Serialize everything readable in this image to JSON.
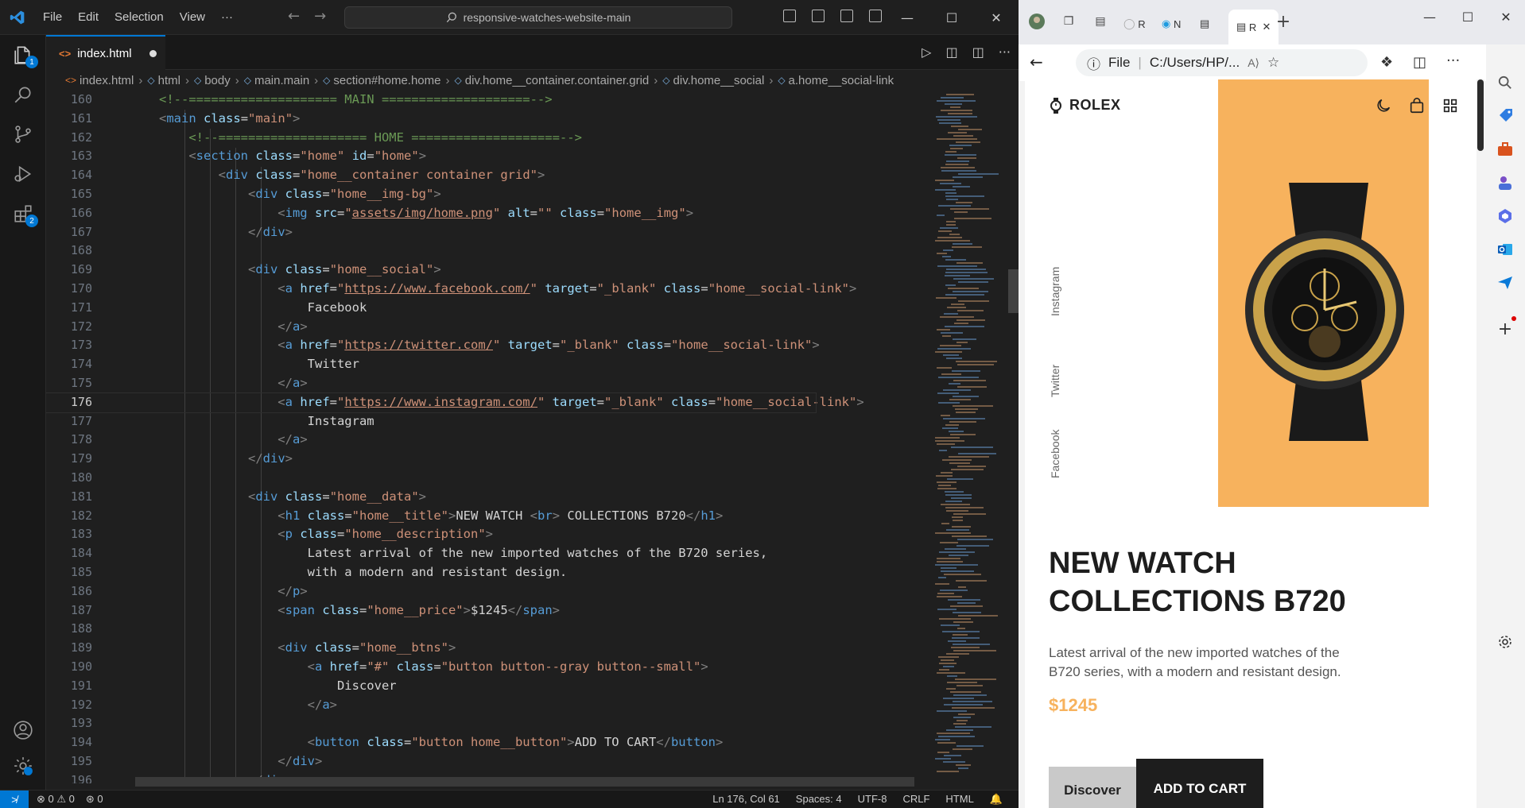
{
  "vscode": {
    "menu": [
      "File",
      "Edit",
      "Selection",
      "View",
      "···"
    ],
    "command_center": "responsive-watches-website-main",
    "tab": {
      "icon": "<>",
      "label": "index.html"
    },
    "activity_badges": {
      "explorer": "1",
      "extensions": "2"
    },
    "breadcrumb": [
      "index.html",
      "html",
      "body",
      "main.main",
      "section#home.home",
      "div.home__container.container.grid",
      "div.home__social",
      "a.home__social-link"
    ],
    "line_numbers": [
      "160",
      "161",
      "162",
      "163",
      "164",
      "165",
      "166",
      "167",
      "168",
      "169",
      "170",
      "171",
      "172",
      "173",
      "174",
      "175",
      "176",
      "177",
      "178",
      "179",
      "180",
      "181",
      "182",
      "183",
      "184",
      "185",
      "186",
      "187",
      "188",
      "189",
      "190",
      "191",
      "192",
      "193",
      "194",
      "195",
      "196"
    ],
    "active_line": "176",
    "status": {
      "errors": "0",
      "warnings": "0",
      "ports": "0",
      "position": "Ln 176, Col 61",
      "spaces": "Spaces: 4",
      "encoding": "UTF-8",
      "eol": "CRLF",
      "language": "HTML"
    }
  },
  "browser": {
    "address": {
      "scheme": "File",
      "path": "C:/Users/HP/..."
    },
    "tabs": [
      "R",
      "N",
      "R"
    ],
    "site": {
      "logo": "ROLEX",
      "social": [
        "Instagram",
        "Twitter",
        "Facebook"
      ],
      "title": "NEW WATCH\nCOLLECTIONS B720",
      "description": "Latest arrival of the new imported watches of the B720 series, with a modern and resistant design.",
      "price": "$1245",
      "discover": "Discover",
      "add_to_cart": "ADD TO CART",
      "accent_color": "#f7b25d"
    }
  },
  "code_lines": [
    [
      [
        "t-cmt",
        "    <!--==================== MAIN ====================-->"
      ]
    ],
    [
      [
        "t-br",
        "    <"
      ],
      [
        "t-tag",
        "main"
      ],
      [
        "t-txt",
        " "
      ],
      [
        "t-attr",
        "class"
      ],
      [
        "t-txt",
        "="
      ],
      [
        "t-str",
        "\"main\""
      ],
      [
        "t-br",
        ">"
      ]
    ],
    [
      [
        "t-cmt",
        "        <!--==================== HOME ====================-->"
      ]
    ],
    [
      [
        "t-br",
        "        <"
      ],
      [
        "t-tag",
        "section"
      ],
      [
        "t-txt",
        " "
      ],
      [
        "t-attr",
        "class"
      ],
      [
        "t-txt",
        "="
      ],
      [
        "t-str",
        "\"home\""
      ],
      [
        "t-txt",
        " "
      ],
      [
        "t-attr",
        "id"
      ],
      [
        "t-txt",
        "="
      ],
      [
        "t-str",
        "\"home\""
      ],
      [
        "t-br",
        ">"
      ]
    ],
    [
      [
        "t-br",
        "            <"
      ],
      [
        "t-tag",
        "div"
      ],
      [
        "t-txt",
        " "
      ],
      [
        "t-attr",
        "class"
      ],
      [
        "t-txt",
        "="
      ],
      [
        "t-str",
        "\"home__container container grid\""
      ],
      [
        "t-br",
        ">"
      ]
    ],
    [
      [
        "t-br",
        "                <"
      ],
      [
        "t-tag",
        "div"
      ],
      [
        "t-txt",
        " "
      ],
      [
        "t-attr",
        "class"
      ],
      [
        "t-txt",
        "="
      ],
      [
        "t-str",
        "\"home__img-bg\""
      ],
      [
        "t-br",
        ">"
      ]
    ],
    [
      [
        "t-br",
        "                    <"
      ],
      [
        "t-tag",
        "img"
      ],
      [
        "t-txt",
        " "
      ],
      [
        "t-attr",
        "src"
      ],
      [
        "t-txt",
        "="
      ],
      [
        "t-str",
        "\""
      ],
      [
        "t-link",
        "assets/img/home.png"
      ],
      [
        "t-str",
        "\""
      ],
      [
        "t-txt",
        " "
      ],
      [
        "t-attr",
        "alt"
      ],
      [
        "t-txt",
        "="
      ],
      [
        "t-str",
        "\"\""
      ],
      [
        "t-txt",
        " "
      ],
      [
        "t-attr",
        "class"
      ],
      [
        "t-txt",
        "="
      ],
      [
        "t-str",
        "\"home__img\""
      ],
      [
        "t-br",
        ">"
      ]
    ],
    [
      [
        "t-br",
        "                </"
      ],
      [
        "t-tag",
        "div"
      ],
      [
        "t-br",
        ">"
      ]
    ],
    [
      [
        "t-txt",
        ""
      ]
    ],
    [
      [
        "t-br",
        "                <"
      ],
      [
        "t-tag",
        "div"
      ],
      [
        "t-txt",
        " "
      ],
      [
        "t-attr",
        "class"
      ],
      [
        "t-txt",
        "="
      ],
      [
        "t-str",
        "\"home__social\""
      ],
      [
        "t-br",
        ">"
      ]
    ],
    [
      [
        "t-br",
        "                    <"
      ],
      [
        "t-tag",
        "a"
      ],
      [
        "t-txt",
        " "
      ],
      [
        "t-attr",
        "href"
      ],
      [
        "t-txt",
        "="
      ],
      [
        "t-str",
        "\""
      ],
      [
        "t-link",
        "https://www.facebook.com/"
      ],
      [
        "t-str",
        "\""
      ],
      [
        "t-txt",
        " "
      ],
      [
        "t-attr",
        "target"
      ],
      [
        "t-txt",
        "="
      ],
      [
        "t-str",
        "\"_blank\""
      ],
      [
        "t-txt",
        " "
      ],
      [
        "t-attr",
        "class"
      ],
      [
        "t-txt",
        "="
      ],
      [
        "t-str",
        "\"home__social-link\""
      ],
      [
        "t-br",
        ">"
      ]
    ],
    [
      [
        "t-txt",
        "                        Facebook"
      ]
    ],
    [
      [
        "t-br",
        "                    </"
      ],
      [
        "t-tag",
        "a"
      ],
      [
        "t-br",
        ">"
      ]
    ],
    [
      [
        "t-br",
        "                    <"
      ],
      [
        "t-tag",
        "a"
      ],
      [
        "t-txt",
        " "
      ],
      [
        "t-attr",
        "href"
      ],
      [
        "t-txt",
        "="
      ],
      [
        "t-str",
        "\""
      ],
      [
        "t-link",
        "https://twitter.com/"
      ],
      [
        "t-str",
        "\""
      ],
      [
        "t-txt",
        " "
      ],
      [
        "t-attr",
        "target"
      ],
      [
        "t-txt",
        "="
      ],
      [
        "t-str",
        "\"_blank\""
      ],
      [
        "t-txt",
        " "
      ],
      [
        "t-attr",
        "class"
      ],
      [
        "t-txt",
        "="
      ],
      [
        "t-str",
        "\"home__social-link\""
      ],
      [
        "t-br",
        ">"
      ]
    ],
    [
      [
        "t-txt",
        "                        Twitter"
      ]
    ],
    [
      [
        "t-br",
        "                    </"
      ],
      [
        "t-tag",
        "a"
      ],
      [
        "t-br",
        ">"
      ]
    ],
    [
      [
        "t-br",
        "                    <"
      ],
      [
        "t-tag",
        "a"
      ],
      [
        "t-txt",
        " "
      ],
      [
        "t-attr",
        "href"
      ],
      [
        "t-txt",
        "="
      ],
      [
        "t-str",
        "\""
      ],
      [
        "t-link",
        "https://www.instagram.com/"
      ],
      [
        "t-str",
        "\""
      ],
      [
        "t-txt",
        " "
      ],
      [
        "t-attr",
        "target"
      ],
      [
        "t-txt",
        "="
      ],
      [
        "t-str",
        "\"_blank\""
      ],
      [
        "t-txt",
        " "
      ],
      [
        "t-attr",
        "class"
      ],
      [
        "t-txt",
        "="
      ],
      [
        "t-str",
        "\"home__social-link\""
      ],
      [
        "t-br",
        ">"
      ]
    ],
    [
      [
        "t-txt",
        "                        Instagram"
      ]
    ],
    [
      [
        "t-br",
        "                    </"
      ],
      [
        "t-tag",
        "a"
      ],
      [
        "t-br",
        ">"
      ]
    ],
    [
      [
        "t-br",
        "                </"
      ],
      [
        "t-tag",
        "div"
      ],
      [
        "t-br",
        ">"
      ]
    ],
    [
      [
        "t-txt",
        ""
      ]
    ],
    [
      [
        "t-br",
        "                <"
      ],
      [
        "t-tag",
        "div"
      ],
      [
        "t-txt",
        " "
      ],
      [
        "t-attr",
        "class"
      ],
      [
        "t-txt",
        "="
      ],
      [
        "t-str",
        "\"home__data\""
      ],
      [
        "t-br",
        ">"
      ]
    ],
    [
      [
        "t-br",
        "                    <"
      ],
      [
        "t-tag",
        "h1"
      ],
      [
        "t-txt",
        " "
      ],
      [
        "t-attr",
        "class"
      ],
      [
        "t-txt",
        "="
      ],
      [
        "t-str",
        "\"home__title\""
      ],
      [
        "t-br",
        ">"
      ],
      [
        "t-txt",
        "NEW WATCH "
      ],
      [
        "t-br",
        "<"
      ],
      [
        "t-tag",
        "br"
      ],
      [
        "t-br",
        ">"
      ],
      [
        "t-txt",
        " COLLECTIONS B720"
      ],
      [
        "t-br",
        "</"
      ],
      [
        "t-tag",
        "h1"
      ],
      [
        "t-br",
        ">"
      ]
    ],
    [
      [
        "t-br",
        "                    <"
      ],
      [
        "t-tag",
        "p"
      ],
      [
        "t-txt",
        " "
      ],
      [
        "t-attr",
        "class"
      ],
      [
        "t-txt",
        "="
      ],
      [
        "t-str",
        "\"home__description\""
      ],
      [
        "t-br",
        ">"
      ]
    ],
    [
      [
        "t-txt",
        "                        Latest arrival of the new imported watches of the B720 series,"
      ]
    ],
    [
      [
        "t-txt",
        "                        with a modern and resistant design."
      ]
    ],
    [
      [
        "t-br",
        "                    </"
      ],
      [
        "t-tag",
        "p"
      ],
      [
        "t-br",
        ">"
      ]
    ],
    [
      [
        "t-br",
        "                    <"
      ],
      [
        "t-tag",
        "span"
      ],
      [
        "t-txt",
        " "
      ],
      [
        "t-attr",
        "class"
      ],
      [
        "t-txt",
        "="
      ],
      [
        "t-str",
        "\"home__price\""
      ],
      [
        "t-br",
        ">"
      ],
      [
        "t-txt",
        "$1245"
      ],
      [
        "t-br",
        "</"
      ],
      [
        "t-tag",
        "span"
      ],
      [
        "t-br",
        ">"
      ]
    ],
    [
      [
        "t-txt",
        ""
      ]
    ],
    [
      [
        "t-br",
        "                    <"
      ],
      [
        "t-tag",
        "div"
      ],
      [
        "t-txt",
        " "
      ],
      [
        "t-attr",
        "class"
      ],
      [
        "t-txt",
        "="
      ],
      [
        "t-str",
        "\"home__btns\""
      ],
      [
        "t-br",
        ">"
      ]
    ],
    [
      [
        "t-br",
        "                        <"
      ],
      [
        "t-tag",
        "a"
      ],
      [
        "t-txt",
        " "
      ],
      [
        "t-attr",
        "href"
      ],
      [
        "t-txt",
        "="
      ],
      [
        "t-str",
        "\"#\""
      ],
      [
        "t-txt",
        " "
      ],
      [
        "t-attr",
        "class"
      ],
      [
        "t-txt",
        "="
      ],
      [
        "t-str",
        "\"button button--gray button--small\""
      ],
      [
        "t-br",
        ">"
      ]
    ],
    [
      [
        "t-txt",
        "                            Discover"
      ]
    ],
    [
      [
        "t-br",
        "                        </"
      ],
      [
        "t-tag",
        "a"
      ],
      [
        "t-br",
        ">"
      ]
    ],
    [
      [
        "t-txt",
        ""
      ]
    ],
    [
      [
        "t-br",
        "                        <"
      ],
      [
        "t-tag",
        "button"
      ],
      [
        "t-txt",
        " "
      ],
      [
        "t-attr",
        "class"
      ],
      [
        "t-txt",
        "="
      ],
      [
        "t-str",
        "\"button home__button\""
      ],
      [
        "t-br",
        ">"
      ],
      [
        "t-txt",
        "ADD TO CART"
      ],
      [
        "t-br",
        "</"
      ],
      [
        "t-tag",
        "button"
      ],
      [
        "t-br",
        ">"
      ]
    ],
    [
      [
        "t-br",
        "                    </"
      ],
      [
        "t-tag",
        "div"
      ],
      [
        "t-br",
        ">"
      ]
    ],
    [
      [
        "t-br",
        "                </"
      ],
      [
        "t-tag",
        "div"
      ],
      [
        "t-br",
        ">"
      ]
    ]
  ]
}
